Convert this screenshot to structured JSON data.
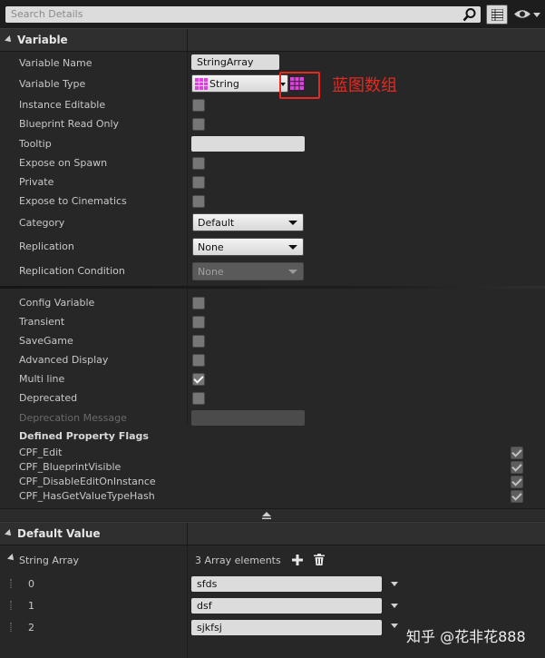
{
  "search": {
    "placeholder": "Search Details"
  },
  "variable_section": {
    "title": "Variable",
    "rows": {
      "variable_name": {
        "label": "Variable Name",
        "value": "StringArray"
      },
      "variable_type": {
        "label": "Variable Type",
        "value": "String"
      },
      "instance_editable": {
        "label": "Instance Editable"
      },
      "blueprint_read_only": {
        "label": "Blueprint Read Only"
      },
      "tooltip": {
        "label": "Tooltip",
        "value": ""
      },
      "expose_on_spawn": {
        "label": "Expose on Spawn"
      },
      "private": {
        "label": "Private"
      },
      "expose_to_cinematics": {
        "label": "Expose to Cinematics"
      },
      "category": {
        "label": "Category",
        "value": "Default"
      },
      "replication": {
        "label": "Replication",
        "value": "None"
      },
      "replication_condition": {
        "label": "Replication Condition",
        "value": "None"
      }
    },
    "annotation": "蓝图数组"
  },
  "advanced": {
    "config_variable": {
      "label": "Config Variable"
    },
    "transient": {
      "label": "Transient"
    },
    "savegame": {
      "label": "SaveGame"
    },
    "advanced_display": {
      "label": "Advanced Display"
    },
    "multi_line": {
      "label": "Multi line",
      "checked": true
    },
    "deprecated": {
      "label": "Deprecated"
    },
    "deprecation_message": {
      "label": "Deprecation Message"
    },
    "flags_title": "Defined Property Flags",
    "flags": [
      "CPF_Edit",
      "CPF_BlueprintVisible",
      "CPF_DisableEditOnInstance",
      "CPF_HasGetValueTypeHash"
    ]
  },
  "default_value": {
    "title": "Default Value",
    "array_label": "String Array",
    "array_count": "3 Array elements",
    "elements": [
      {
        "index": "0",
        "value": "sfds"
      },
      {
        "index": "1",
        "value": "dsf"
      },
      {
        "index": "2",
        "value": "sjkfsj"
      }
    ]
  },
  "watermark": "知乎 @花非花888",
  "colors": {
    "type_pink": "#e040e0",
    "annotation_red": "#e8281e"
  }
}
